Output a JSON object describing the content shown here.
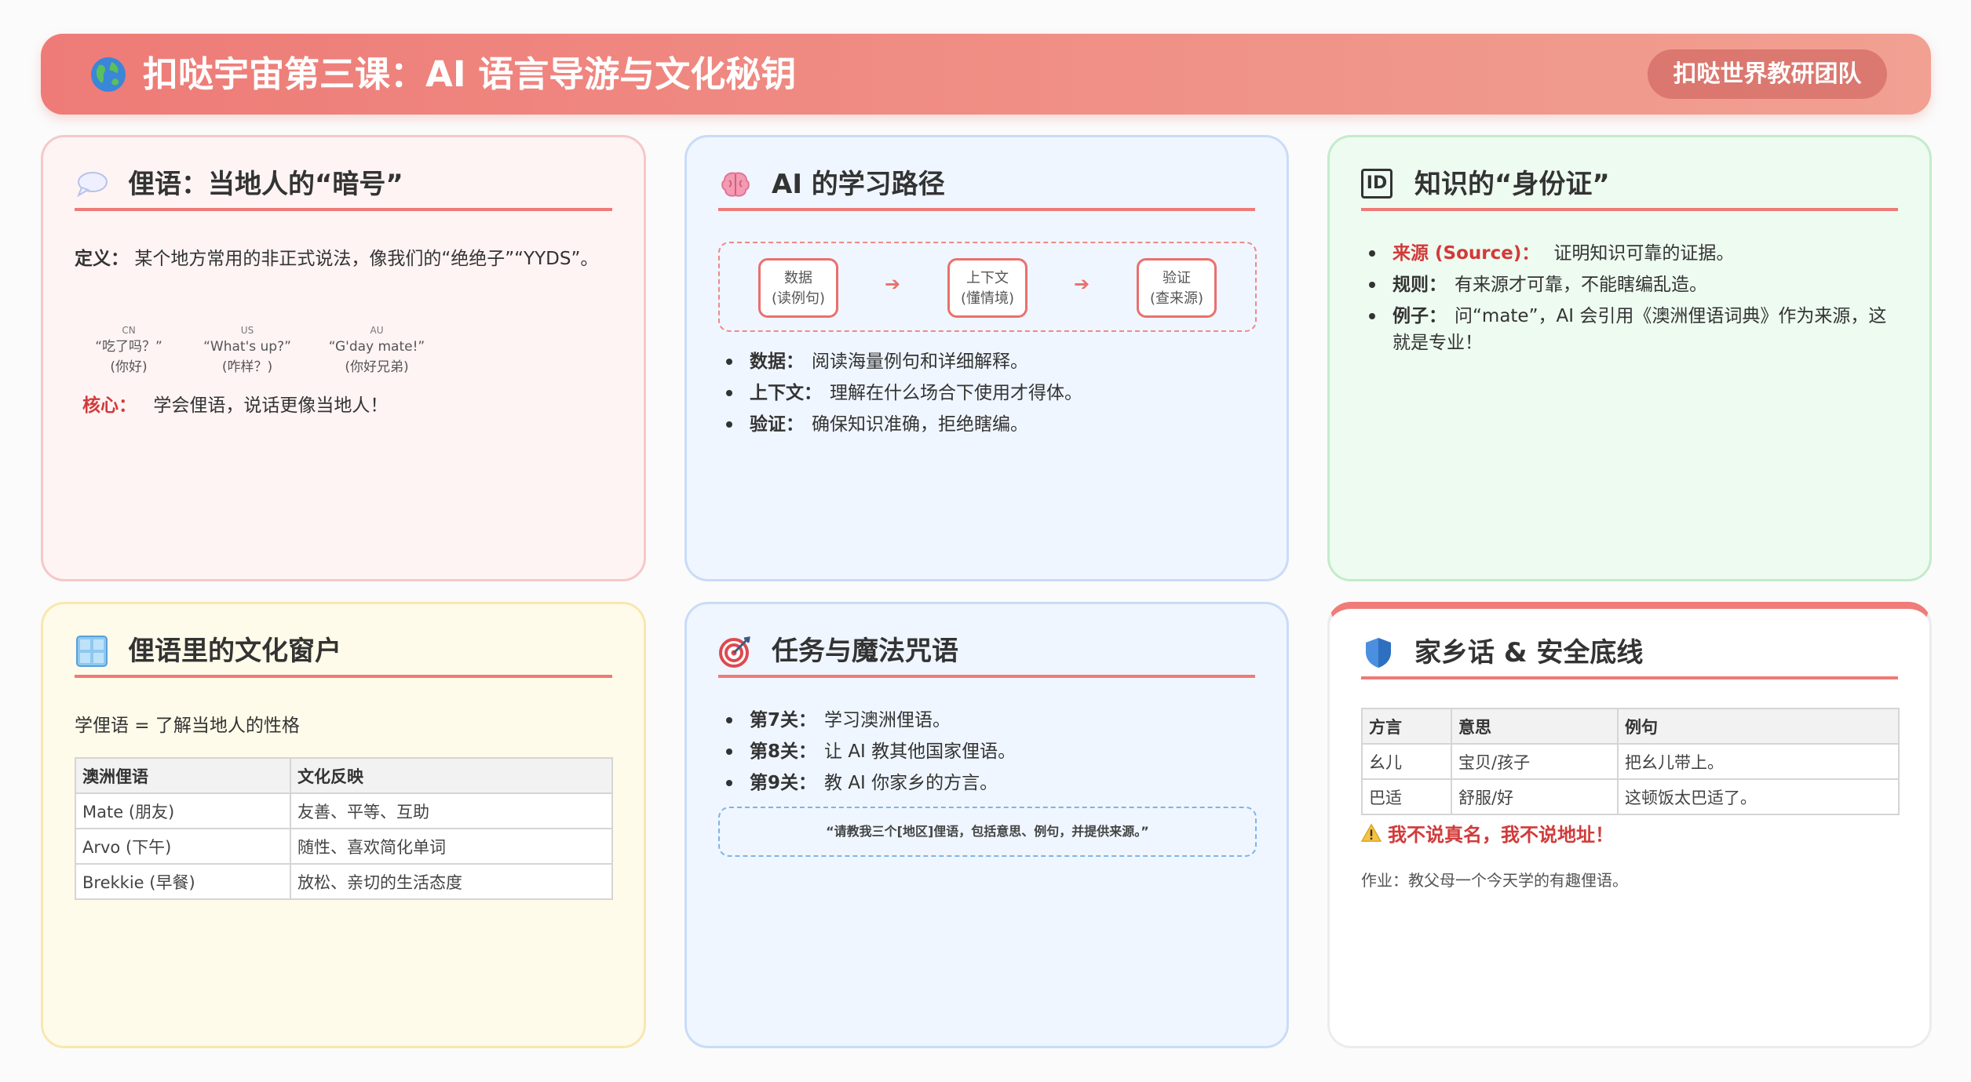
{
  "header": {
    "title": "扣哒宇宙第三课：AI 语言导游与文化秘钥",
    "team": "扣哒世界教研团队"
  },
  "slang_card": {
    "title": "俚语：当地人的“暗号”",
    "definition_label": "定义：",
    "definition_text": "某个地方常用的非正式说法，像我们的“绝绝子”“YYDS”。",
    "greetings": [
      {
        "code": "CN",
        "phrase": "“吃了吗？”",
        "meaning": "(你好)"
      },
      {
        "code": "US",
        "phrase": "“What's up?”",
        "meaning": "(咋样？)"
      },
      {
        "code": "AU",
        "phrase": "“G'day mate!”",
        "meaning": "(你好兄弟)"
      }
    ],
    "core_label": "核心：",
    "core_text": "学会俚语，说话更像当地人！"
  },
  "ai_card": {
    "title": "AI 的学习路径",
    "flow": [
      {
        "line1": "数据",
        "line2": "(读例句)"
      },
      {
        "line1": "上下文",
        "line2": "(懂情境)"
      },
      {
        "line1": "验证",
        "line2": "(查来源)"
      }
    ],
    "arrow": "➔",
    "bullets": [
      {
        "label": "数据：",
        "text": "阅读海量例句和详细解释。"
      },
      {
        "label": "上下文：",
        "text": "理解在什么场合下使用才得体。"
      },
      {
        "label": "验证：",
        "text": "确保知识准确，拒绝瞎编。"
      }
    ]
  },
  "id_card": {
    "icon_text": "ID",
    "title": "知识的“身份证”",
    "bullets": [
      {
        "label": "来源 (Source)：",
        "text": "证明知识可靠的证据。",
        "highlight": true
      },
      {
        "label": "规则：",
        "text": "有来源才可靠，不能瞎编乱造。",
        "highlight": false
      },
      {
        "label": "例子：",
        "text": "问“mate”，AI 会引用《澳洲俚语词典》作为来源，这就是专业！",
        "highlight": false
      }
    ]
  },
  "culture_card": {
    "title": "俚语里的文化窗户",
    "intro": "学俚语 = 了解当地人的性格",
    "table": {
      "headers": [
        "澳洲俚语",
        "文化反映"
      ],
      "rows": [
        [
          "Mate (朋友)",
          "友善、平等、互助"
        ],
        [
          "Arvo (下午)",
          "随性、喜欢简化单词"
        ],
        [
          "Brekkie (早餐)",
          "放松、亲切的生活态度"
        ]
      ]
    }
  },
  "task_card": {
    "title": "任务与魔法咒语",
    "bullets": [
      {
        "label": "第7关：",
        "text": "学习澳洲俚语。"
      },
      {
        "label": "第8关：",
        "text": "让 AI 教其他国家俚语。"
      },
      {
        "label": "第9关：",
        "text": "教 AI 你家乡的方言。"
      }
    ],
    "prompt": "“请教我三个[地区]俚语，包括意思、例句，并提供来源。”"
  },
  "dialect_card": {
    "title": "家乡话 & 安全底线",
    "table": {
      "headers": [
        "方言",
        "意思",
        "例句"
      ],
      "rows": [
        [
          "幺儿",
          "宝贝/孩子",
          "把幺儿带上。"
        ],
        [
          "巴适",
          "舒服/好",
          "这顿饭太巴适了。"
        ]
      ]
    },
    "warning": "我不说真名，我不说地址！",
    "homework": "作业：教父母一个今天学的有趣俚语。"
  },
  "colors": {
    "accent": "#ee7b77",
    "danger": "#d23a3a",
    "card_pink": "#fff4f4",
    "card_blue": "#eff6ff",
    "card_green": "#eefbf0",
    "card_yellow": "#fffbea"
  },
  "icons": [
    "globe-icon",
    "speech-bubble-icon",
    "brain-icon",
    "id-badge-icon",
    "window-icon",
    "target-icon",
    "shield-icon",
    "warning-icon"
  ]
}
